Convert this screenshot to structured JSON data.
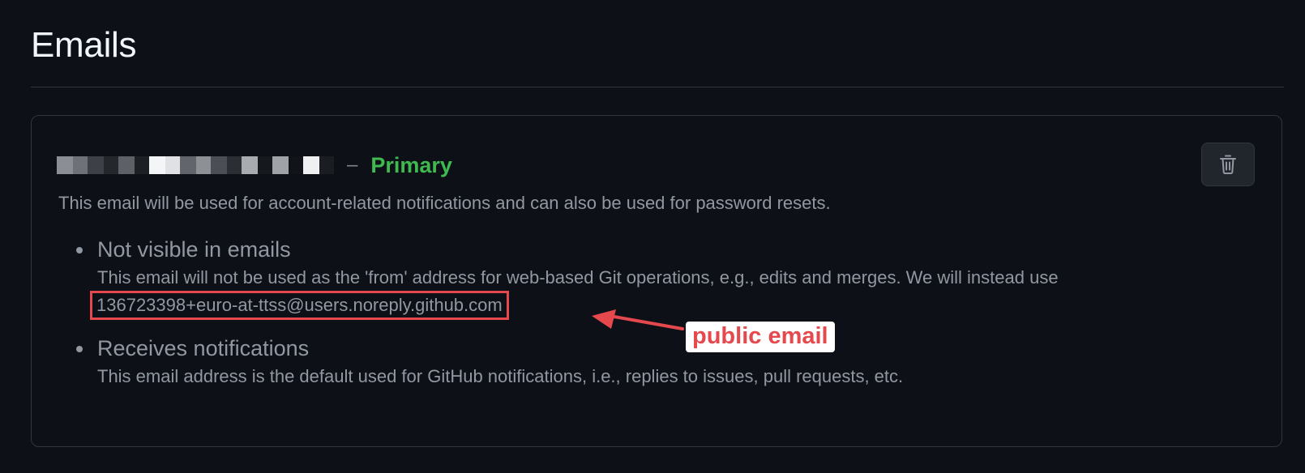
{
  "header": {
    "title": "Emails"
  },
  "email_card": {
    "separator": "–",
    "primary_label": "Primary",
    "description": "This email will be used for account-related notifications and can also be used for password resets.",
    "items": [
      {
        "title": "Not visible in emails",
        "text": "This email will not be used as the 'from' address for web-based Git operations, e.g., edits and merges. We will instead use",
        "noreply_address": "136723398+euro-at-ttss@users.noreply.github.com"
      },
      {
        "title": "Receives notifications",
        "text": "This email address is the default used for GitHub notifications, i.e., replies to issues, pull requests, etc."
      }
    ],
    "delete_icon": "trash-icon"
  },
  "annotation": {
    "label": "public email",
    "color": "#e5484d"
  },
  "colors": {
    "background": "#0d1117",
    "primary_green": "#3fb950",
    "muted_text": "#9198a1",
    "border": "#30363d",
    "annotation_red": "#e5484d"
  }
}
